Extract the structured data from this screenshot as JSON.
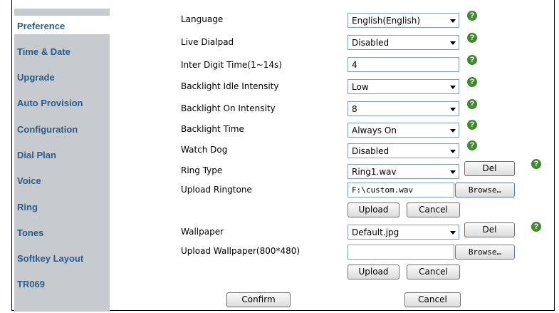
{
  "sidebar": {
    "items": [
      {
        "label": "Preference"
      },
      {
        "label": "Time & Date"
      },
      {
        "label": "Upgrade"
      },
      {
        "label": "Auto Provision"
      },
      {
        "label": "Configuration"
      },
      {
        "label": "Dial Plan"
      },
      {
        "label": "Voice"
      },
      {
        "label": "Ring"
      },
      {
        "label": "Tones"
      },
      {
        "label": "Softkey Layout"
      },
      {
        "label": "TR069"
      }
    ]
  },
  "form": {
    "language": {
      "label": "Language",
      "value": "English(English)"
    },
    "live_dialpad": {
      "label": "Live Dialpad",
      "value": "Disabled"
    },
    "inter_digit": {
      "label": "Inter Digit Time(1~14s)",
      "value": "4"
    },
    "backlight_idle": {
      "label": "Backlight Idle Intensity",
      "value": "Low"
    },
    "backlight_on": {
      "label": "Backlight On Intensity",
      "value": "8"
    },
    "backlight_time": {
      "label": "Backlight Time",
      "value": "Always On"
    },
    "watch_dog": {
      "label": "Watch Dog",
      "value": "Disabled"
    },
    "ring_type": {
      "label": "Ring Type",
      "value": "Ring1.wav",
      "del_label": "Del"
    },
    "upload_ringtone": {
      "label": "Upload Ringtone",
      "file_value": "F:\\custom.wav",
      "browse_label": "Browse…",
      "upload_label": "Upload",
      "cancel_label": "Cancel"
    },
    "wallpaper": {
      "label": "Wallpaper",
      "value": "Default.jpg",
      "del_label": "Del"
    },
    "upload_wallpaper": {
      "label": "Upload Wallpaper(800*480)",
      "file_value": "",
      "browse_label": "Browse…",
      "upload_label": "Upload",
      "cancel_label": "Cancel"
    }
  },
  "footer": {
    "confirm_label": "Confirm",
    "cancel_label": "Cancel"
  },
  "help_icon": {
    "glyph": "?",
    "color": "#3d8b2a"
  },
  "colors": {
    "sidebar_bg": "#c7cbcf",
    "nav_text": "#2a5c88"
  }
}
